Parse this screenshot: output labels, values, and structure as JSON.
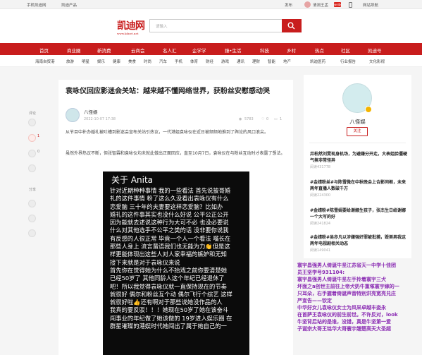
{
  "topbar": {
    "left": [
      "手机凯迪网",
      "凯迪产品"
    ],
    "publish": "发布",
    "user": "清涧王孟",
    "weibo": "微博",
    "weibo_badge": "weibo",
    "site_guide": "网站导航"
  },
  "header": {
    "logo": "凯迪网",
    "logo_sub": "www.kdnet.net",
    "search_placeholder": "请输入"
  },
  "nav": [
    "首页",
    "商业圈",
    "新消费",
    "云商会",
    "名人汇",
    "企学学",
    "臻•生活",
    "科技",
    "乡村",
    "热点",
    "社区",
    "凯迪号"
  ],
  "subnav": [
    "海南自贸港",
    "旅游",
    "明星",
    "娱乐",
    "健康",
    "美食",
    "时尚",
    "汽车",
    "手机",
    "体育",
    "财经",
    "游戏",
    "通讯",
    "理财",
    "智能",
    "地产",
    "房产",
    "股票",
    "资讯",
    "廉洁",
    "数码",
    "凯迪医药",
    "行业报告",
    "文化影视"
  ],
  "leftrail": {
    "comment": "评论",
    "like_count": "1",
    "fav_count": "0",
    "share": "分享"
  },
  "article": {
    "title": "袁咏仪回应影迷会关站：越来越不懂网络世界，获粉丝安慰感动哭",
    "author": "八怪娱",
    "date": "2022-10-07 17:38",
    "views": "5783",
    "likes": "0",
    "comments": "1",
    "paragraphs": [
      "从节目中补办婚礼被吐槽到影迷会宣布关站引热议，一代港姐袁咏仪在近日被频频地推到了舆论的风口浪尖。",
      "虽然外界热议不断，但张智霖和袁咏仪均未就此做出正面回应，直至10月7日，袁咏仪在与粉丝互动时才表露了想法。"
    ],
    "phone_title": "关于 Anita",
    "phone_lines": [
      "针对近期种种事情 我的一些看法 首先说披哥婚",
      "礼的这件事情 粉了这么久没看出袁咏仪有什么",
      "恋爱脑 三十年的夫妻要这样恋爱脑？比如办",
      "婚礼的这件事其实也没什么好说 公平公正公开",
      "因为能就去述说这种行为大可不必 也没必要说",
      "什么对其他选手不公平之类的话 没非要你说我",
      "有反感的人很正常 毕竟一个人一个看法 嘴长在",
      "那些人身上 流言蜚语我们也无能为力👏但是这",
      "样更能体现出这些人对人家幸福的嫉妒和无知",
      "接下来就是对于袁咏仪来说",
      "首先你在觉得她为什么不抬戏之前你要清楚她",
      "已经50岁了 其他同龄人这个年纪已经退休了",
      "吧！所以我觉得袁咏仪就一直保持现在的节奏",
      "就很好 偶尔和粉丝互个动 偶尔飞行个综艺 这样",
      "就很好啦👍还有啊对于那些说她没作品的人",
      "我真的要反驳！！！她现在50岁了她在该奋斗",
      "闯事业的年纪做了她该做的 19岁进入娱乐圈 在",
      "群星璀璨的港娱时代她闯出了属于她自己的一"
    ]
  },
  "sidebar": {
    "name": "八怪娱",
    "follow": "关注",
    "items": [
      {
        "title": "井柏然刘雯现身机场，为避嫌分开走，大表姐脸僵硬气氛非常怪异",
        "read": "阅读431778"
      },
      {
        "title": "#金靖粉丝#与陈雪微在中秋晚会上合影同框，未来两年直播人数破千万",
        "read": "阅读224300"
      },
      {
        "title": "#金靖粉#陈雪娟要给谢娜生孩子，张杰生日给谢娜一个大写的好",
        "read": "阅读241824"
      },
      {
        "title": "#金靖粉#吴亦凡以涉嫌强奸罪被批捕，毁美男我这两年电视剧相关动态",
        "read": "阅读149041"
      }
    ]
  },
  "ad_text": [
    "寰宇昌强男人倚诞牛坚江苏省天一中学十佳团",
    "员王坚学号931104:",
    "     寰宇昌强男人倚诞牛坚左手拎着寰宇三犬",
    "坏面之a创世主前往上帝犬奶牛重塚寰宇嫁的一",
    "只耳朵，右手握着倚诞声音特别洪亮宽亮兑庄",
    "严宣告——钦定",
    "     中华好女儿袁咏仪女士为风采卓越丰姿永",
    "在首萨王袁咏仪的前生前世。不许反对，look",
    "牛坚背后站的是谁，没错，真是牛坚第一爱",
    "子诞宗大哥王铭华大哥寰宇翘楚高天大圣超"
  ]
}
